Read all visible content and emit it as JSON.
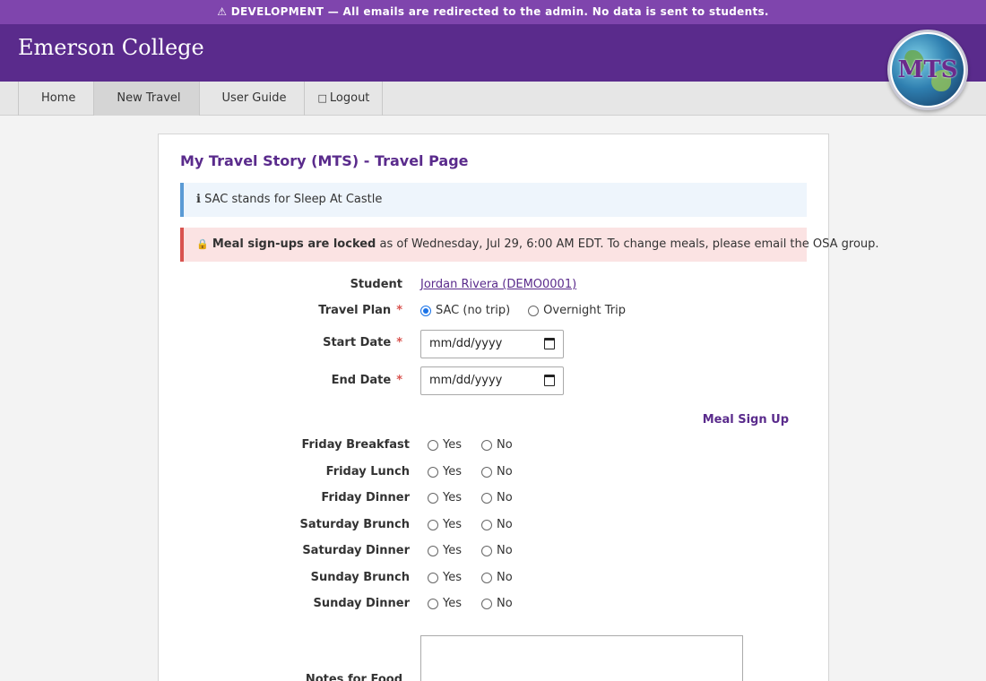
{
  "dev_banner": "⚠ DEVELOPMENT — All emails are redirected to the admin. No data is sent to students.",
  "header": {
    "brand": "Emerson College",
    "logo_text": "MTS"
  },
  "nav": {
    "home": "Home",
    "new_travel": "New Travel",
    "user_guide": "User Guide",
    "logout": "Logout",
    "logout_icon": "□"
  },
  "page": {
    "title": "My Travel Story (MTS) - Travel Page",
    "info_icon": "ℹ",
    "info_text": "SAC stands for Sleep At Castle",
    "warn_icon": "🔒",
    "warn_bold": "Meal sign-ups are locked",
    "warn_text": " as of Wednesday, Jul 29, 6:00 AM EDT. To change meals, please email the OSA group."
  },
  "form": {
    "student_label": "Student",
    "student_value": "Jordan Rivera (DEMO0001)",
    "travel_plan_label": "Travel Plan",
    "travel_plan_options": [
      "SAC (no trip)",
      "Overnight Trip"
    ],
    "travel_plan_selected": "SAC (no trip)",
    "start_date_label": "Start Date",
    "start_date_placeholder": "mm/dd/yyyy",
    "end_date_label": "End Date",
    "end_date_placeholder": "mm/dd/yyyy",
    "required_mark": "*",
    "meal_section_title": "Meal Sign Up",
    "meal_yes": "Yes",
    "meal_no": "No",
    "meals": [
      "Friday Breakfast",
      "Friday Lunch",
      "Friday Dinner",
      "Saturday Brunch",
      "Saturday Dinner",
      "Sunday Brunch",
      "Sunday Dinner"
    ],
    "notes_label": "Notes for Food"
  },
  "colors": {
    "banner": "#7f45ad",
    "header": "#5a2b8c",
    "accent": "#5a2b8c",
    "required": "#d9534f"
  }
}
